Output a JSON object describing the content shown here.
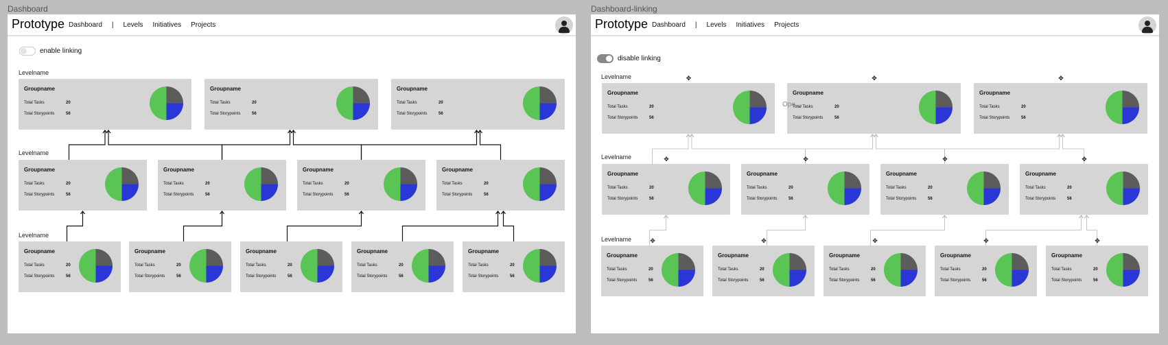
{
  "frames": [
    {
      "label": "Dashboard",
      "brand": "Prototype",
      "nav": [
        "Dashboard",
        "|",
        "Levels",
        "Initiatives",
        "Projects"
      ],
      "toggle": {
        "label": "enable linking",
        "state": "off"
      },
      "levels": [
        "Levelname",
        "Levelname",
        "Levelname"
      ]
    },
    {
      "label": "Dashboard-linking",
      "brand": "Prototype",
      "nav": [
        "Dashboard",
        "|",
        "Levels",
        "Initiatives",
        "Projects"
      ],
      "toggle": {
        "label": "disable linking",
        "state": "on"
      },
      "levels": [
        "Levelname",
        "Levelname",
        "Levelname"
      ],
      "tooltip_text": "Ope..."
    }
  ],
  "card": {
    "title": "Groupname",
    "tasks_label": "Total Tasks",
    "tasks_value": "20",
    "storypoints_label": "Total Storypoints",
    "storypoints_value": "56"
  },
  "colors": {
    "pie_gray": "#5c5c5c",
    "pie_blue": "#2a37d6",
    "pie_green": "#5ac554",
    "card_bg": "#d5d5d5",
    "background": "#bdbdbd"
  },
  "icons": {
    "avatar": "user-icon",
    "drag": "move-icon"
  }
}
